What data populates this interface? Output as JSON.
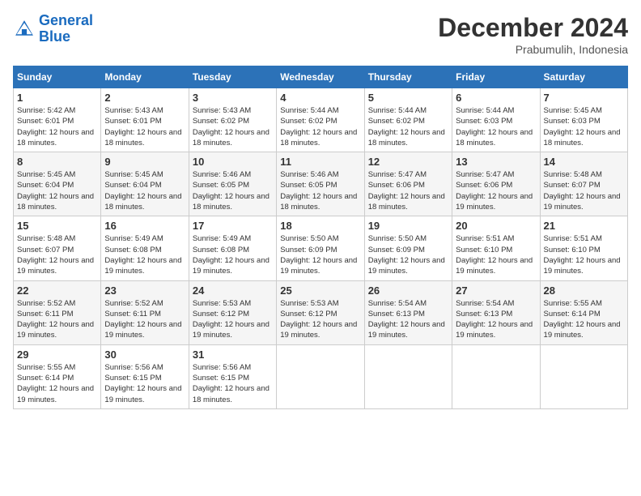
{
  "header": {
    "logo_general": "General",
    "logo_blue": "Blue",
    "month": "December 2024",
    "location": "Prabumulih, Indonesia"
  },
  "weekdays": [
    "Sunday",
    "Monday",
    "Tuesday",
    "Wednesday",
    "Thursday",
    "Friday",
    "Saturday"
  ],
  "weeks": [
    [
      {
        "day": "1",
        "sunrise": "5:42 AM",
        "sunset": "6:01 PM",
        "daylight": "12 hours and 18 minutes."
      },
      {
        "day": "2",
        "sunrise": "5:43 AM",
        "sunset": "6:01 PM",
        "daylight": "12 hours and 18 minutes."
      },
      {
        "day": "3",
        "sunrise": "5:43 AM",
        "sunset": "6:02 PM",
        "daylight": "12 hours and 18 minutes."
      },
      {
        "day": "4",
        "sunrise": "5:44 AM",
        "sunset": "6:02 PM",
        "daylight": "12 hours and 18 minutes."
      },
      {
        "day": "5",
        "sunrise": "5:44 AM",
        "sunset": "6:02 PM",
        "daylight": "12 hours and 18 minutes."
      },
      {
        "day": "6",
        "sunrise": "5:44 AM",
        "sunset": "6:03 PM",
        "daylight": "12 hours and 18 minutes."
      },
      {
        "day": "7",
        "sunrise": "5:45 AM",
        "sunset": "6:03 PM",
        "daylight": "12 hours and 18 minutes."
      }
    ],
    [
      {
        "day": "8",
        "sunrise": "5:45 AM",
        "sunset": "6:04 PM",
        "daylight": "12 hours and 18 minutes."
      },
      {
        "day": "9",
        "sunrise": "5:45 AM",
        "sunset": "6:04 PM",
        "daylight": "12 hours and 18 minutes."
      },
      {
        "day": "10",
        "sunrise": "5:46 AM",
        "sunset": "6:05 PM",
        "daylight": "12 hours and 18 minutes."
      },
      {
        "day": "11",
        "sunrise": "5:46 AM",
        "sunset": "6:05 PM",
        "daylight": "12 hours and 18 minutes."
      },
      {
        "day": "12",
        "sunrise": "5:47 AM",
        "sunset": "6:06 PM",
        "daylight": "12 hours and 18 minutes."
      },
      {
        "day": "13",
        "sunrise": "5:47 AM",
        "sunset": "6:06 PM",
        "daylight": "12 hours and 19 minutes."
      },
      {
        "day": "14",
        "sunrise": "5:48 AM",
        "sunset": "6:07 PM",
        "daylight": "12 hours and 19 minutes."
      }
    ],
    [
      {
        "day": "15",
        "sunrise": "5:48 AM",
        "sunset": "6:07 PM",
        "daylight": "12 hours and 19 minutes."
      },
      {
        "day": "16",
        "sunrise": "5:49 AM",
        "sunset": "6:08 PM",
        "daylight": "12 hours and 19 minutes."
      },
      {
        "day": "17",
        "sunrise": "5:49 AM",
        "sunset": "6:08 PM",
        "daylight": "12 hours and 19 minutes."
      },
      {
        "day": "18",
        "sunrise": "5:50 AM",
        "sunset": "6:09 PM",
        "daylight": "12 hours and 19 minutes."
      },
      {
        "day": "19",
        "sunrise": "5:50 AM",
        "sunset": "6:09 PM",
        "daylight": "12 hours and 19 minutes."
      },
      {
        "day": "20",
        "sunrise": "5:51 AM",
        "sunset": "6:10 PM",
        "daylight": "12 hours and 19 minutes."
      },
      {
        "day": "21",
        "sunrise": "5:51 AM",
        "sunset": "6:10 PM",
        "daylight": "12 hours and 19 minutes."
      }
    ],
    [
      {
        "day": "22",
        "sunrise": "5:52 AM",
        "sunset": "6:11 PM",
        "daylight": "12 hours and 19 minutes."
      },
      {
        "day": "23",
        "sunrise": "5:52 AM",
        "sunset": "6:11 PM",
        "daylight": "12 hours and 19 minutes."
      },
      {
        "day": "24",
        "sunrise": "5:53 AM",
        "sunset": "6:12 PM",
        "daylight": "12 hours and 19 minutes."
      },
      {
        "day": "25",
        "sunrise": "5:53 AM",
        "sunset": "6:12 PM",
        "daylight": "12 hours and 19 minutes."
      },
      {
        "day": "26",
        "sunrise": "5:54 AM",
        "sunset": "6:13 PM",
        "daylight": "12 hours and 19 minutes."
      },
      {
        "day": "27",
        "sunrise": "5:54 AM",
        "sunset": "6:13 PM",
        "daylight": "12 hours and 19 minutes."
      },
      {
        "day": "28",
        "sunrise": "5:55 AM",
        "sunset": "6:14 PM",
        "daylight": "12 hours and 19 minutes."
      }
    ],
    [
      {
        "day": "29",
        "sunrise": "5:55 AM",
        "sunset": "6:14 PM",
        "daylight": "12 hours and 19 minutes."
      },
      {
        "day": "30",
        "sunrise": "5:56 AM",
        "sunset": "6:15 PM",
        "daylight": "12 hours and 19 minutes."
      },
      {
        "day": "31",
        "sunrise": "5:56 AM",
        "sunset": "6:15 PM",
        "daylight": "12 hours and 18 minutes."
      },
      null,
      null,
      null,
      null
    ]
  ]
}
